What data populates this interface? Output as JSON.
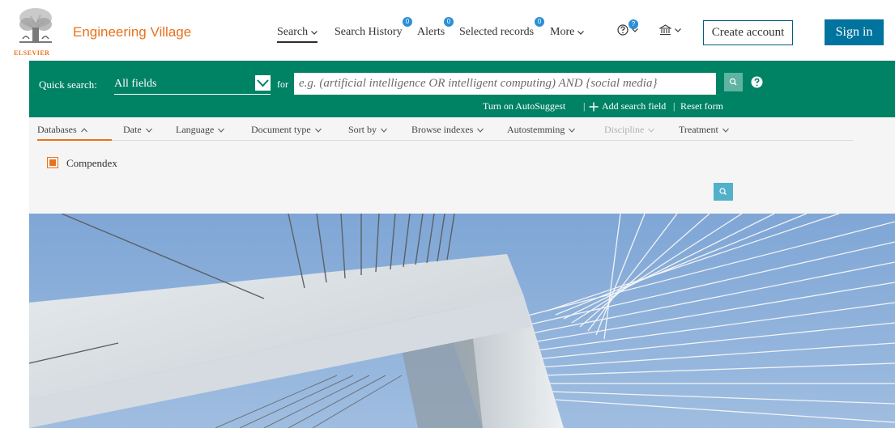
{
  "brand": {
    "publisher": "ELSEVIER",
    "name": "Engineering Village"
  },
  "nav": {
    "search": "Search",
    "search_history": "Search History",
    "search_history_badge": "0",
    "alerts": "Alerts",
    "alerts_badge": "0",
    "selected_records": "Selected records",
    "selected_records_badge": "0",
    "more": "More",
    "help_badge": "?"
  },
  "account": {
    "create": "Create account",
    "signin": "Sign in"
  },
  "quick_search": {
    "label": "Quick search:",
    "field_value": "All fields",
    "for_label": "for",
    "placeholder": "e.g. (artificial intelligence OR intelligent computing) AND {social media}",
    "links": {
      "autosuggest": "Turn on AutoSuggest",
      "add_field": "Add search field",
      "reset": "Reset form"
    }
  },
  "options": [
    {
      "label": "Databases",
      "state": "open"
    },
    {
      "label": "Date",
      "state": "closed"
    },
    {
      "label": "Language",
      "state": "closed"
    },
    {
      "label": "Document type",
      "state": "closed"
    },
    {
      "label": "Sort by",
      "state": "closed"
    },
    {
      "label": "Browse indexes",
      "state": "closed"
    },
    {
      "label": "Autostemming",
      "state": "closed"
    },
    {
      "label": "Discipline",
      "state": "disabled"
    },
    {
      "label": "Treatment",
      "state": "closed"
    }
  ],
  "databases": [
    {
      "label": "Compendex",
      "checked": true
    }
  ],
  "colors": {
    "brand_orange": "#e9711c",
    "band_green": "#008265",
    "signin_blue": "#00739e",
    "badge_blue": "#2b8fd6"
  }
}
